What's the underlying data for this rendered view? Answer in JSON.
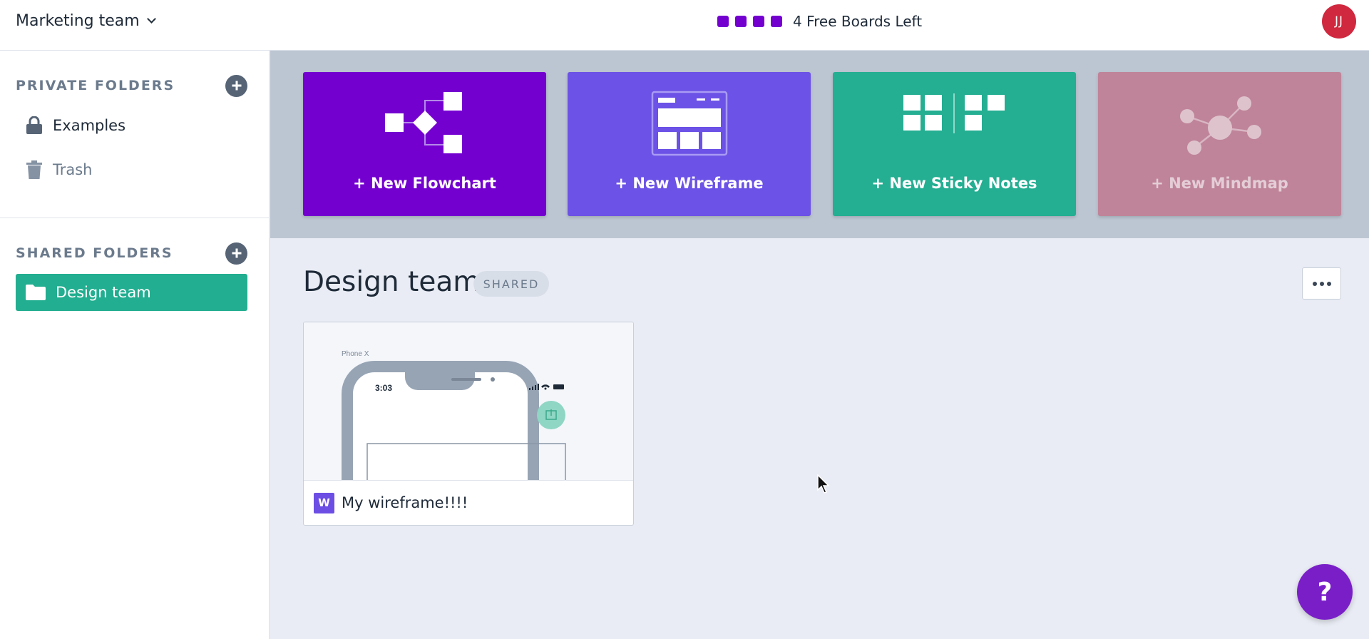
{
  "header": {
    "team_name": "Marketing team",
    "free_boards_text": "4 Free Boards Left",
    "free_board_squares": 4,
    "avatar_initials": "JJ",
    "accent_color": "#7400d0"
  },
  "sidebar": {
    "private_title": "PRIVATE FOLDERS",
    "private_items": [
      {
        "label": "Examples",
        "icon": "lock-icon"
      },
      {
        "label": "Trash",
        "icon": "trash-icon"
      }
    ],
    "shared_title": "SHARED FOLDERS",
    "shared_items": [
      {
        "label": "Design team",
        "icon": "folder-icon",
        "active": true
      }
    ]
  },
  "templates": [
    {
      "label": "+ New Flowchart",
      "color": "#7400d0",
      "icon": "flowchart-icon"
    },
    {
      "label": "+ New Wireframe",
      "color": "#6c52e6",
      "icon": "wireframe-icon"
    },
    {
      "label": "+ New Sticky Notes",
      "color": "#24ae92",
      "icon": "sticky-notes-icon"
    },
    {
      "label": "+ New Mindmap",
      "color": "#bf8499",
      "icon": "mindmap-icon"
    }
  ],
  "folder": {
    "title": "Design team",
    "badge": "SHARED"
  },
  "boards": [
    {
      "name": "My wireframe!!!!",
      "type_letter": "W",
      "thumb": {
        "device_label": "Phone X",
        "time": "3:03"
      }
    }
  ],
  "help": {
    "label": "?"
  }
}
